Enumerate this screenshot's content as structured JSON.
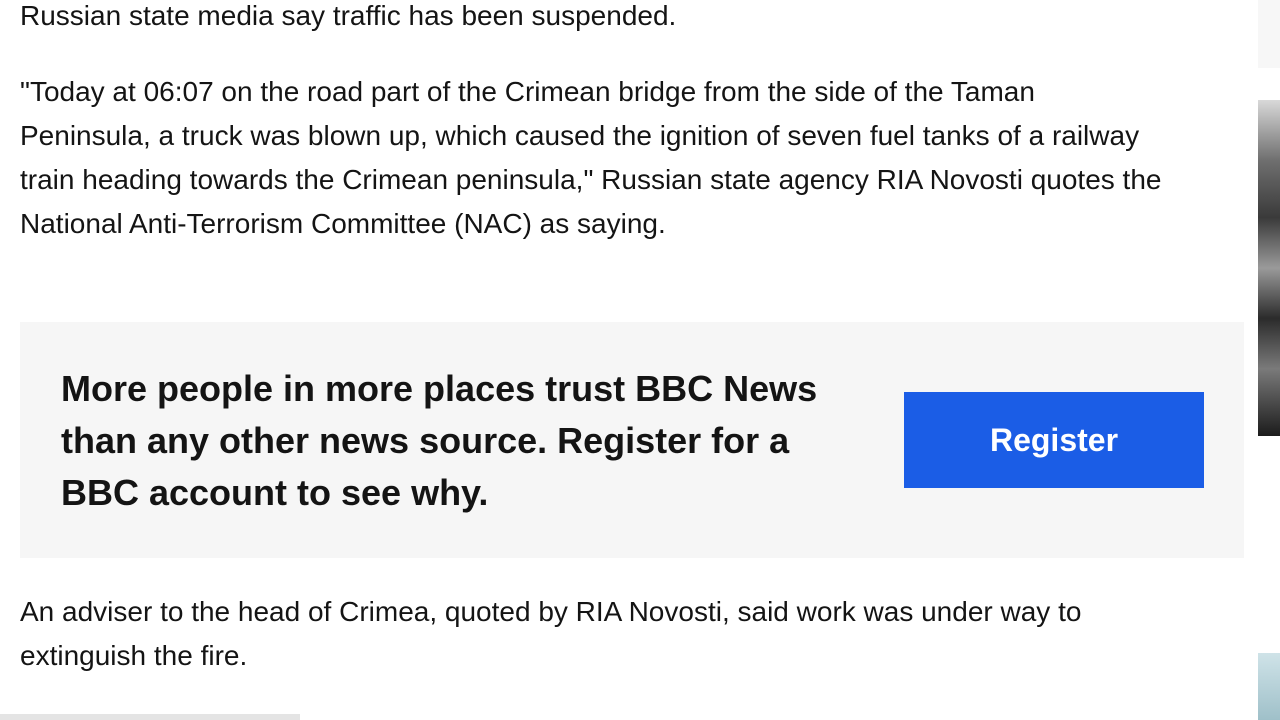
{
  "article": {
    "para_top": "Russian state media say traffic has been suspended.",
    "para_quote": "\"Today at 06:07 on the road part of the Crimean bridge from the side of the Taman Peninsula, a truck was blown up, which caused the ignition of seven fuel tanks of a railway train heading towards the Crimean peninsula,\" Russian state agency RIA Novosti quotes the National Anti-Terrorism Committee (NAC) as saying.",
    "para_adviser": "An adviser to the head of Crimea, quoted by RIA Novosti, said work was under way to extinguish the fire."
  },
  "promo": {
    "text": "More people in more places trust BBC News than any other news source. Register for a BBC account to see why.",
    "button_label": "Register",
    "button_color": "#1b5de6"
  }
}
